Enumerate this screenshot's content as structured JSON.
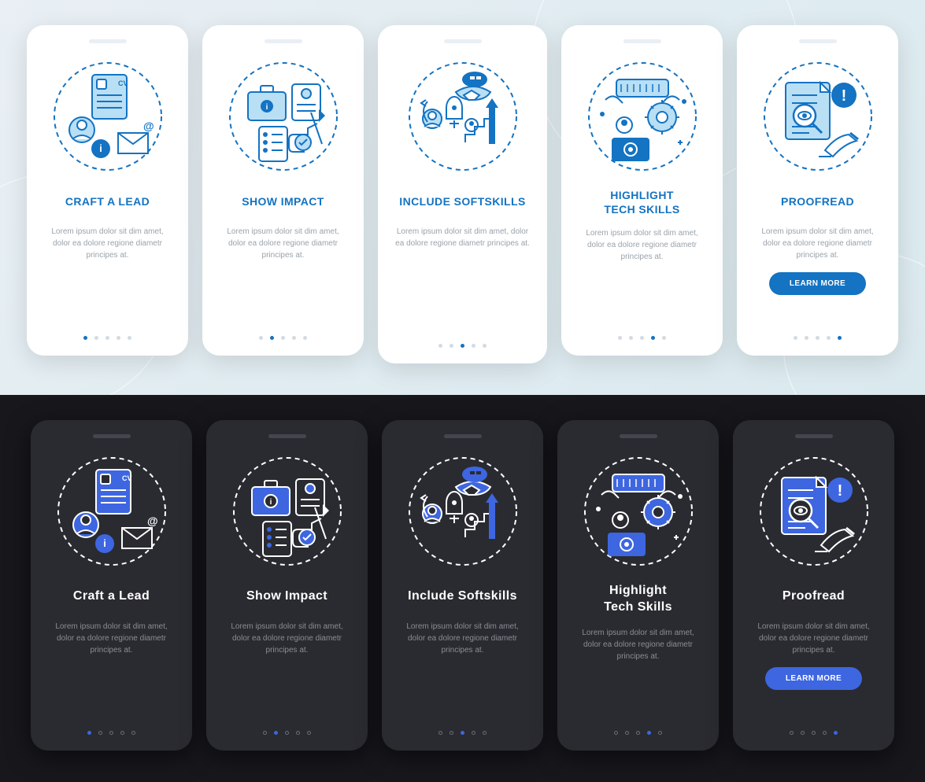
{
  "body_text": "Lorem ipsum dolor sit dim amet, dolor ea dolore regione diametr principes at.",
  "cta_label": "LEARN MORE",
  "light": {
    "cards": [
      {
        "title": "CRAFT A LEAD",
        "icon": "cv-contact"
      },
      {
        "title": "SHOW IMPACT",
        "icon": "briefcase-checklist"
      },
      {
        "title": "INCLUDE SOFTSKILLS",
        "icon": "handshake-growth"
      },
      {
        "title": "HIGHLIGHT\nTECH SKILLS",
        "icon": "keyboard-gear"
      },
      {
        "title": "PROOFREAD",
        "icon": "magnify-edit"
      }
    ]
  },
  "dark": {
    "cards": [
      {
        "title": "Craft a Lead",
        "icon": "cv-contact"
      },
      {
        "title": "Show Impact",
        "icon": "briefcase-checklist"
      },
      {
        "title": "Include Softskills",
        "icon": "handshake-growth"
      },
      {
        "title": "Highlight\nTech Skills",
        "icon": "keyboard-gear"
      },
      {
        "title": "Proofread",
        "icon": "magnify-edit"
      }
    ]
  },
  "colors": {
    "light_accent": "#1473c2",
    "dark_accent": "#3d66e0",
    "light_bg_tint": "#b9dff5"
  }
}
